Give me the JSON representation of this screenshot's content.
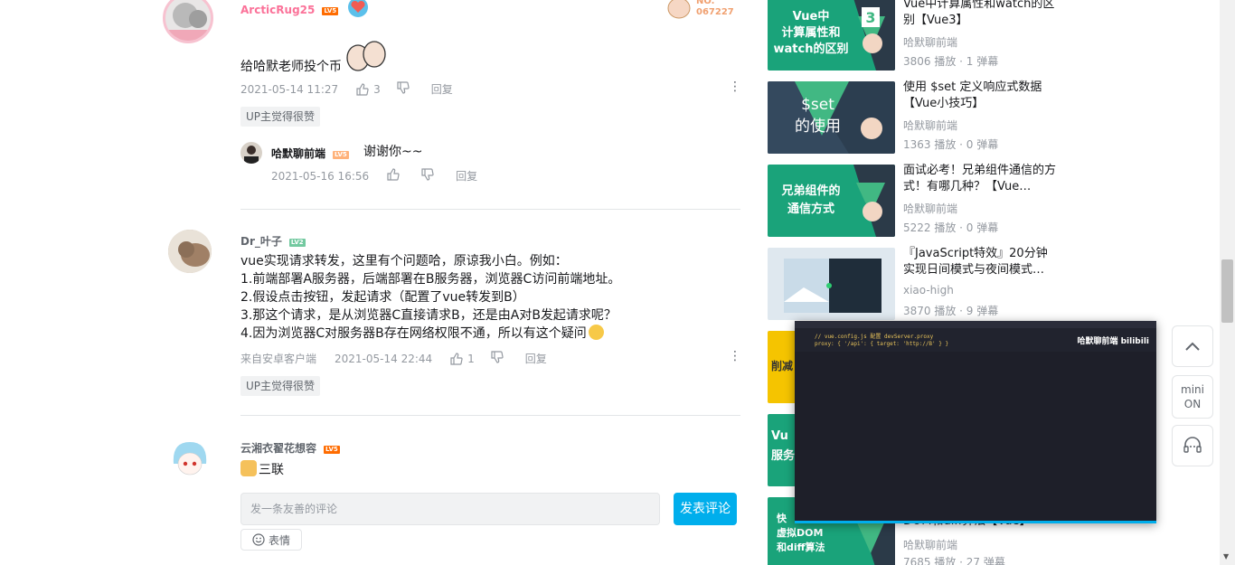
{
  "comments": [
    {
      "user": "ArcticRug25",
      "level": "LV5",
      "fan_badge": "NO.\n067227",
      "text": "给哈默老师投个币",
      "time": "2021-05-14 11:27",
      "likes": "3",
      "reply_label": "回复",
      "up_badge": "UP主觉得很赞",
      "reply": {
        "user": "哈默聊前端",
        "level": "LV5",
        "text": "谢谢你~~",
        "time": "2021-05-16 16:56",
        "reply_label": "回复"
      }
    },
    {
      "user": "Dr_叶子",
      "level": "LV2",
      "lines": [
        "vue实现请求转发，这里有个问题哈，原谅我小白。例如：",
        "1.前端部署A服务器，后端部署在B服务器，浏览器C访问前端地址。",
        "2.假设点击按钮，发起请求（配置了vue转发到B）",
        "3.那这个请求，是从浏览器C直接请求B，还是由A对B发起请求呢？",
        "4.因为浏览器C对服务器B存在网络权限不通，所以有这个疑问"
      ],
      "source": "来自安卓客户端",
      "time": "2021-05-14 22:44",
      "likes": "1",
      "reply_label": "回复",
      "up_badge": "UP主觉得很赞"
    },
    {
      "user": "云湘衣翟花想容",
      "level": "LV5",
      "text": "三联"
    }
  ],
  "reply_box": {
    "placeholder": "发一条友善的评论",
    "send": "发表评论",
    "emoji": "表情"
  },
  "videos": [
    {
      "thumb_text": "Vue中\n计算属性和\nwatch的区别",
      "badge": "3",
      "title": "Vue中计算属性和watch的区别【Vue3】",
      "author": "哈默聊前端",
      "stats": "3806 播放 · 1 弹幕"
    },
    {
      "thumb_text": "$set\n的使用",
      "title": "使用 $set 定义响应式数据【Vue小技巧】",
      "author": "哈默聊前端",
      "stats": "1363 播放 · 0 弹幕"
    },
    {
      "thumb_text": "兄弟组件的\n通信方式",
      "title": "面试必考！兄弟组件通信的方式！有哪几种？【Vue…",
      "author": "哈默聊前端",
      "stats": "5222 播放 · 0 弹幕"
    },
    {
      "title": "『JavaScript特效』20分钟实现日间模式与夜间模式…",
      "author": "xiao-high",
      "stats": "3870 播放 · 9 弹幕"
    },
    {
      "thumb_text": "削减"
    },
    {
      "thumb_text": "Vu\n服务"
    },
    {
      "thumb_text": "快\n虚拟DOM\n和diff算法",
      "title": "DOM和diff算法【Vue】",
      "author": "哈默聊前端",
      "stats": "7685 播放 · 27 弹幕"
    }
  ],
  "float_buttons": {
    "mini_label": "mini",
    "mini_state": "ON"
  },
  "mini_player": {
    "brand": "哈默聊前端 bilibili",
    "code_line1": "// vue.config.js 配置 devServer.proxy",
    "code_line2": "proxy: { '/api': { target: 'http://B' } }"
  },
  "colors": {
    "accent": "#00aeec",
    "username_pink": "#fb7299",
    "level5": "#ff6c00",
    "level2": "#73c9a0"
  }
}
